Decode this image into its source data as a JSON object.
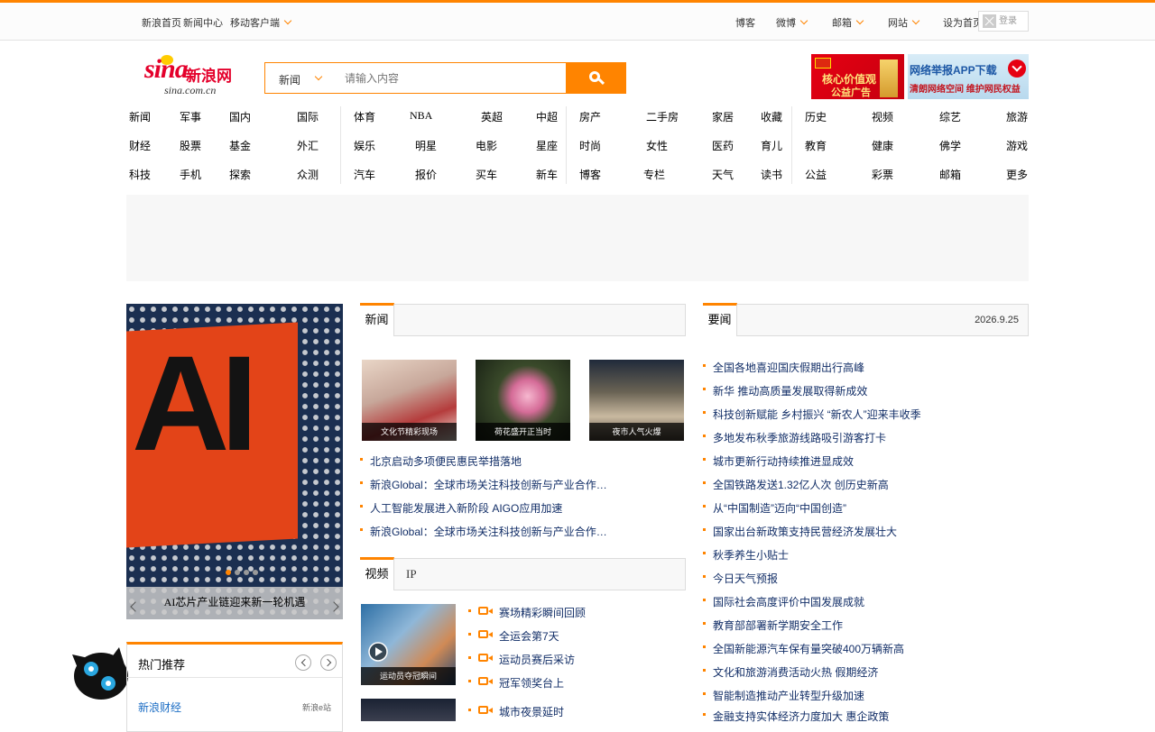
{
  "topbar": {
    "left_links": [
      "新浪首页",
      "新闻中心",
      "移动客户端"
    ],
    "right_links": [
      "博客",
      "微博",
      "邮箱",
      "网站"
    ],
    "plain_link": "设为首页",
    "login_label": "登录"
  },
  "logo": {
    "brand": "sina",
    "cn": "新浪网",
    "domain": "sina.com.cn"
  },
  "search": {
    "category": "新闻",
    "placeholder": "请输入内容"
  },
  "ads": {
    "ad1_line1": "核心价值观",
    "ad1_line2": "公益广告",
    "ad2_line1": "网络举报APP下载",
    "ad2_line2": "清朗网络空间 维护网民权益"
  },
  "nav": {
    "groups": [
      [
        "新闻",
        "军事",
        "国内",
        "国际",
        "财经",
        "股票",
        "基金",
        "外汇",
        "科技",
        "手机",
        "探索",
        "众测"
      ],
      [
        "体育",
        "NBA",
        "英超",
        "中超",
        "娱乐",
        "明星",
        "电影",
        "星座",
        "汽车",
        "报价",
        "买车",
        "新车"
      ],
      [
        "房产",
        "二手房",
        "家居",
        "收藏",
        "时尚",
        "女性",
        "医药",
        "育儿",
        "博客",
        "专栏",
        "天气",
        "读书"
      ],
      [
        "历史",
        "视频",
        "综艺",
        "旅游",
        "教育",
        "健康",
        "佛学",
        "游戏",
        "公益",
        "彩票",
        "邮箱",
        "更多"
      ]
    ]
  },
  "slider": {
    "caption": "AI芯片产业链迎来新一轮机遇",
    "art_text": "AI"
  },
  "news_panel": {
    "tab": "新闻",
    "photos": [
      "文化节精彩现场",
      "荷花盛开正当时",
      "夜市人气火爆"
    ],
    "items": [
      "北京启动多项便民惠民举措落地",
      "新浪Global：全球市场关注科技创新与产业合作…",
      "人工智能发展进入新阶段 AIGO应用加速",
      "新浪Global：全球市场关注科技创新与产业合作…"
    ]
  },
  "video_panel": {
    "tab": "视频",
    "subtitle": "IP",
    "thumb_caption": "运动员夺冠瞬间",
    "items": [
      "赛场精彩瞬间回顾",
      "全运会第7天",
      "运动员赛后采访",
      "冠军领奖台上",
      "城市夜景延时"
    ]
  },
  "hot_panel": {
    "tab": "要闻",
    "date": "2026.9.25",
    "items": [
      "全国各地喜迎国庆假期出行高峰",
      "新华 推动高质量发展取得新成效",
      "科技创新赋能 乡村振兴 “新农人”迎来丰收季",
      "多地发布秋季旅游线路吸引游客打卡",
      "城市更新行动持续推进显成效",
      "全国铁路发送1.32亿人次 创历史新高",
      "从“中国制造”迈向“中国创造”",
      "国家出台新政策支持民营经济发展壮大",
      "秋季养生小贴士",
      "今日天气预报",
      "国际社会高度评价中国发展成就",
      "教育部部署新学期安全工作",
      "全国新能源汽车保有量突破400万辆新高",
      "文化和旅游消费活动火热 假期经济",
      "智能制造推动产业转型升级加速",
      "金融支持实体经济力度加大 惠企政策"
    ]
  },
  "hot_box": {
    "title": "热门推荐",
    "first_item": "新浪财经",
    "meta": "新浪e站"
  }
}
